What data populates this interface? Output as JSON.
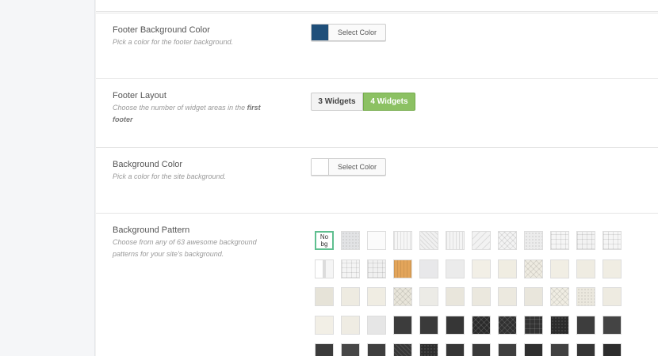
{
  "settings": {
    "footer_bg_color": {
      "label": "Footer Background Color",
      "description": "Pick a color for the footer background.",
      "swatch_color": "#1f4f7a",
      "button_label": "Select Color"
    },
    "footer_layout": {
      "label": "Footer Layout",
      "description_pre": "Choose the number of widget areas in the ",
      "description_bold": "first footer",
      "options": [
        "3 Widgets",
        "4 Widgets"
      ],
      "selected": "4 Widgets"
    },
    "bg_color": {
      "label": "Background Color",
      "description": "Pick a color for the site background.",
      "swatch_color": "#ffffff",
      "button_label": "Select Color"
    },
    "bg_pattern": {
      "label": "Background Pattern",
      "description": "Choose from any of 63 awesome background patterns for your site's background.",
      "no_bg_label": "No bg",
      "selected": "No bg"
    }
  },
  "accent_colors": {
    "selected_button": "#8cc163",
    "selected_tile_border": "#5fbf8f"
  }
}
